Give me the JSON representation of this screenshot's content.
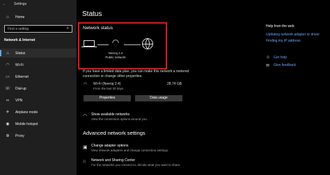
{
  "window": {
    "title": "Settings"
  },
  "sidebar": {
    "home_label": "Home",
    "search_placeholder": "Find a setting",
    "section_title": "Network & Internet",
    "items": [
      {
        "label": "Status",
        "icon": "home-icon"
      },
      {
        "label": "Wi-Fi",
        "icon": "wifi-icon"
      },
      {
        "label": "Ethernet",
        "icon": "ethernet-icon"
      },
      {
        "label": "Dial-up",
        "icon": "phone-icon"
      },
      {
        "label": "VPN",
        "icon": "vpn-icon"
      },
      {
        "label": "Airplane mode",
        "icon": "airplane-icon"
      },
      {
        "label": "Mobile hotspot",
        "icon": "hotspot-icon"
      },
      {
        "label": "Proxy",
        "icon": "globe-icon"
      }
    ]
  },
  "main": {
    "page_title": "Status",
    "network_status_title": "Network status",
    "network_name": "Neeraj 2.4",
    "network_type": "Public network",
    "data_plan_text": "If you have a limited data plan, you can make this network a metered connection or change other properties.",
    "connection": {
      "name": "Wi-Fi (Neeraj 2.4)",
      "subtitle": "From the last 30 days",
      "usage": "28.74 GB"
    },
    "properties_button": "Properties",
    "data_usage_button": "Data usage",
    "show_networks_title": "Show available networks",
    "show_networks_desc": "View the connection options around you.",
    "advanced_title": "Advanced network settings",
    "adapter_title": "Change adapter options",
    "adapter_desc": "View network adapters and change connection settings.",
    "sharing_title": "Network and Sharing Center",
    "sharing_desc": "For the networks you connect to, decide what you want to share."
  },
  "help": {
    "title": "Help from the web",
    "links": [
      "Updating network adapter or driver",
      "Finding my IP address"
    ],
    "get_help": "Get help",
    "feedback": "Give feedback"
  },
  "colors": {
    "accent": "#6aa8ff",
    "highlight_box": "#e0161c"
  }
}
